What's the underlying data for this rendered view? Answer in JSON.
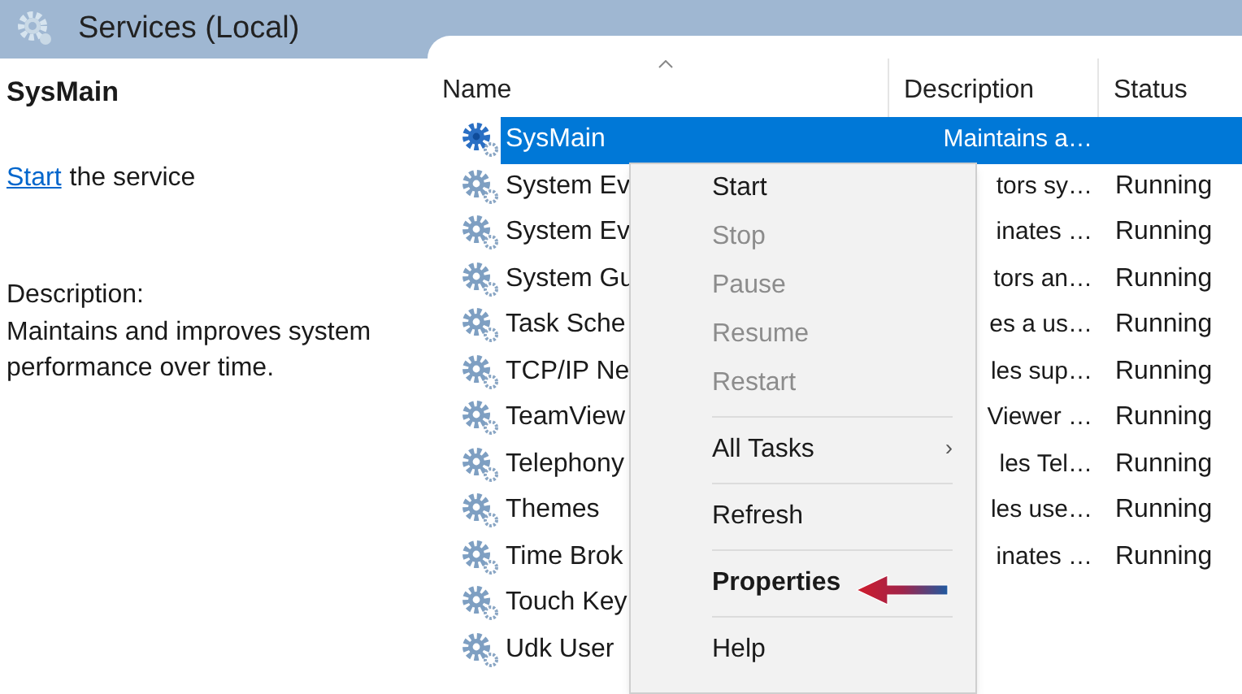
{
  "window": {
    "title": "Services (Local)"
  },
  "detail": {
    "service_name": "SysMain",
    "action_link": "Start",
    "action_text": "the service",
    "description_label": "Description:",
    "description": "Maintains and improves system performance over time."
  },
  "table": {
    "columns": [
      {
        "label": "Name",
        "sorted": true
      },
      {
        "label": "Description",
        "sorted": false
      },
      {
        "label": "Status",
        "sorted": false
      }
    ],
    "rows": [
      {
        "name": "SysMain",
        "description": "Maintains a…",
        "selected": true
      },
      {
        "name": "System Ev",
        "description": "tors sy…",
        "status": "Running",
        "selected": false
      },
      {
        "name": "System Ev",
        "description": "inates …",
        "status": "Running",
        "selected": false
      },
      {
        "name": "System Gu",
        "description": "tors an…",
        "status": "Running",
        "selected": false
      },
      {
        "name": "Task Sche",
        "description": "es a us…",
        "status": "Running",
        "selected": false
      },
      {
        "name": "TCP/IP Ne",
        "description": "les sup…",
        "status": "Running",
        "selected": false
      },
      {
        "name": "TeamView",
        "description": "Viewer …",
        "status": "Running",
        "selected": false
      },
      {
        "name": "Telephony",
        "description": "les Tel…",
        "status": "Running",
        "selected": false
      },
      {
        "name": "Themes",
        "description": "les use…",
        "status": "Running",
        "selected": false
      },
      {
        "name": "Time Brok",
        "description": "inates …",
        "status": "Running",
        "selected": false
      },
      {
        "name": "Touch Key",
        "selected": false
      },
      {
        "name": "Udk User",
        "selected": false
      }
    ]
  },
  "context_menu": {
    "items": [
      {
        "kind": "item",
        "label": "Start",
        "disabled": false
      },
      {
        "kind": "item",
        "label": "Stop",
        "disabled": true
      },
      {
        "kind": "item",
        "label": "Pause",
        "disabled": true
      },
      {
        "kind": "item",
        "label": "Resume",
        "disabled": true
      },
      {
        "kind": "item",
        "label": "Restart",
        "disabled": true
      },
      {
        "kind": "separator"
      },
      {
        "kind": "submenu",
        "label": "All Tasks",
        "arrow": "›",
        "disabled": false
      },
      {
        "kind": "separator"
      },
      {
        "kind": "item",
        "label": "Refresh",
        "disabled": false
      },
      {
        "kind": "separator"
      },
      {
        "kind": "item",
        "label": "Properties",
        "disabled": false,
        "default": true
      },
      {
        "kind": "separator"
      },
      {
        "kind": "item",
        "label": "Help",
        "disabled": false
      }
    ]
  }
}
